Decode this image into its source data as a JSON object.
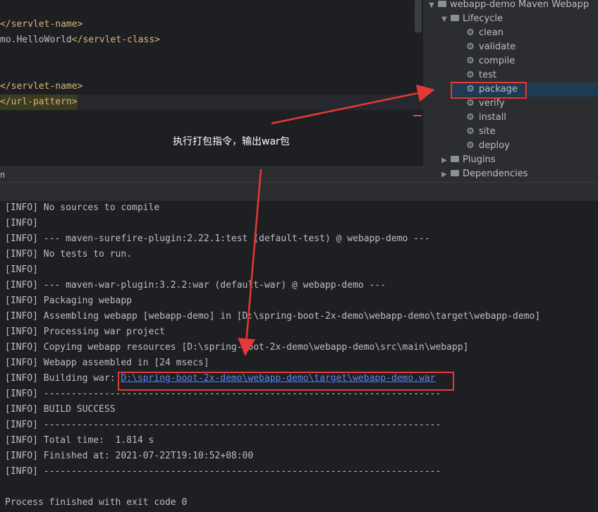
{
  "editor": {
    "lines": [
      {
        "text": "</servlet-name>"
      },
      {
        "text": "mo.HelloWorld</servlet-class>"
      },
      {
        "text": "</servlet-name>"
      },
      {
        "text": "</url-pattern>"
      }
    ]
  },
  "maven": {
    "project": "webapp-demo Maven Webapp",
    "lifecycle": "Lifecycle",
    "phases": [
      "clean",
      "validate",
      "compile",
      "test",
      "package",
      "verify",
      "install",
      "site",
      "deploy"
    ],
    "plugins": "Plugins",
    "dependencies": "Dependencies",
    "selected_phase": "package"
  },
  "panel_label": "n",
  "annotation": "执行打包指令，输出war包",
  "console": {
    "lines": [
      "[INFO] No sources to compile",
      "[INFO]",
      "[INFO] --- maven-surefire-plugin:2.22.1:test (default-test) @ webapp-demo ---",
      "[INFO] No tests to run.",
      "[INFO]",
      "[INFO] --- maven-war-plugin:3.2.2:war (default-war) @ webapp-demo ---",
      "[INFO] Packaging webapp",
      "[INFO] Assembling webapp [webapp-demo] in [D:\\spring-boot-2x-demo\\webapp-demo\\target\\webapp-demo]",
      "[INFO] Processing war project",
      "[INFO] Copying webapp resources [D:\\spring-boot-2x-demo\\webapp-demo\\src\\main\\webapp]",
      "[INFO] Webapp assembled in [24 msecs]"
    ],
    "building_prefix": "[INFO] Building war: ",
    "building_link": "D:\\spring-boot-2x-demo\\webapp-demo\\target\\webapp-demo.war",
    "after_lines": [
      "[INFO] ------------------------------------------------------------------------",
      "[INFO] BUILD SUCCESS",
      "[INFO] ------------------------------------------------------------------------",
      "[INFO] Total time:  1.814 s",
      "[INFO] Finished at: 2021-07-22T19:10:52+08:00",
      "[INFO] ------------------------------------------------------------------------",
      "",
      "Process finished with exit code 0"
    ]
  },
  "colors": {
    "highlight_box": "#e53935",
    "link": "#548af7",
    "tag": "#d5b778"
  }
}
